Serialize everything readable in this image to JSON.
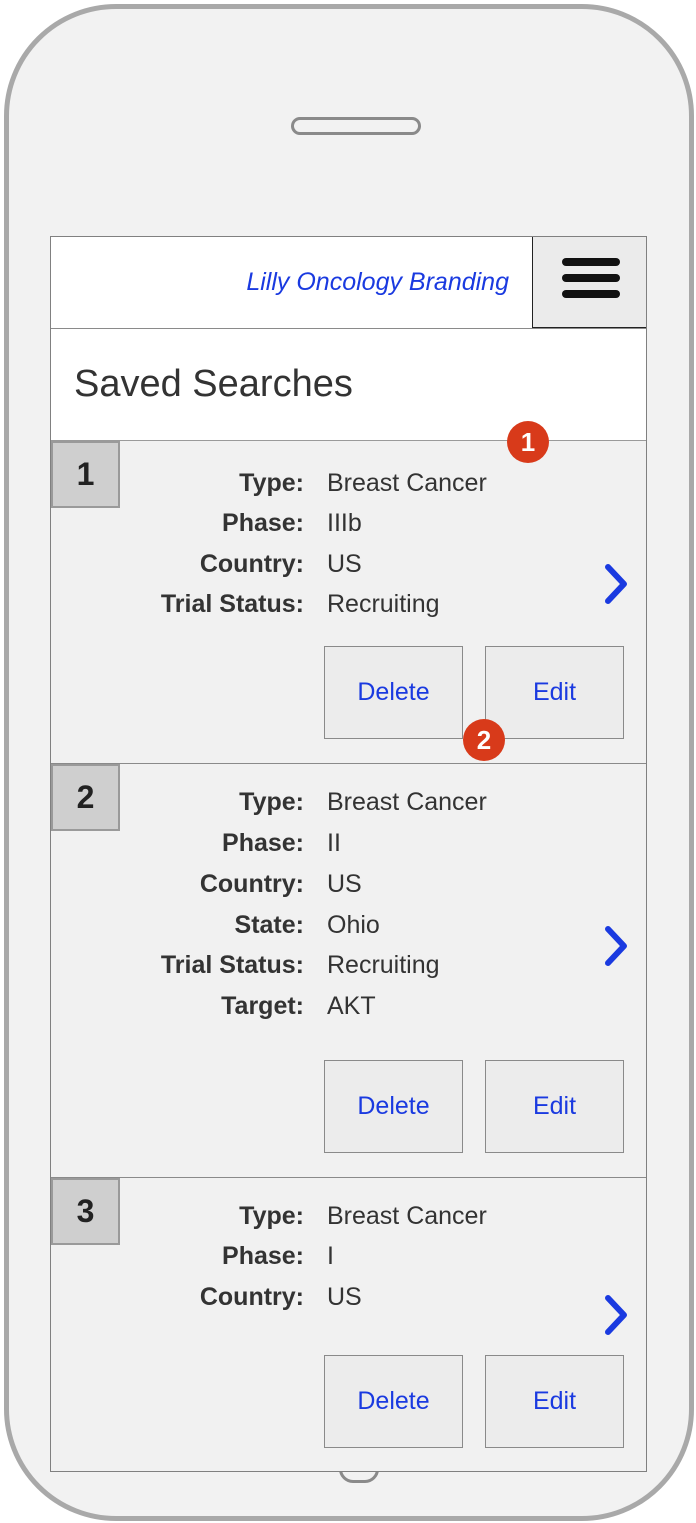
{
  "header": {
    "brand": "Lilly Oncology Branding",
    "menu_icon": "hamburger-icon"
  },
  "page": {
    "title": "Saved Searches"
  },
  "annotations": [
    "1",
    "2"
  ],
  "colors": {
    "link": "#1a3ae0",
    "annotation": "#d83a1a",
    "badge_bg": "#cfcfcf"
  },
  "cards": [
    {
      "number": "1",
      "fields": [
        {
          "label": "Type:",
          "value": "Breast Cancer"
        },
        {
          "label": "Phase:",
          "value": "IIIb"
        },
        {
          "label": "Country:",
          "value": "US"
        },
        {
          "label": "Trial Status:",
          "value": "Recruiting"
        }
      ],
      "delete_label": "Delete",
      "edit_label": "Edit"
    },
    {
      "number": "2",
      "fields": [
        {
          "label": "Type:",
          "value": "Breast Cancer"
        },
        {
          "label": "Phase:",
          "value": "II"
        },
        {
          "label": "Country:",
          "value": "US"
        },
        {
          "label": "State:",
          "value": "Ohio"
        },
        {
          "label": "Trial Status:",
          "value": "Recruiting"
        },
        {
          "label": "Target:",
          "value": "AKT"
        }
      ],
      "delete_label": "Delete",
      "edit_label": "Edit"
    },
    {
      "number": "3",
      "fields": [
        {
          "label": "Type:",
          "value": "Breast Cancer"
        },
        {
          "label": "Phase:",
          "value": "I"
        },
        {
          "label": "Country:",
          "value": "US"
        }
      ],
      "delete_label": "Delete",
      "edit_label": "Edit"
    }
  ]
}
